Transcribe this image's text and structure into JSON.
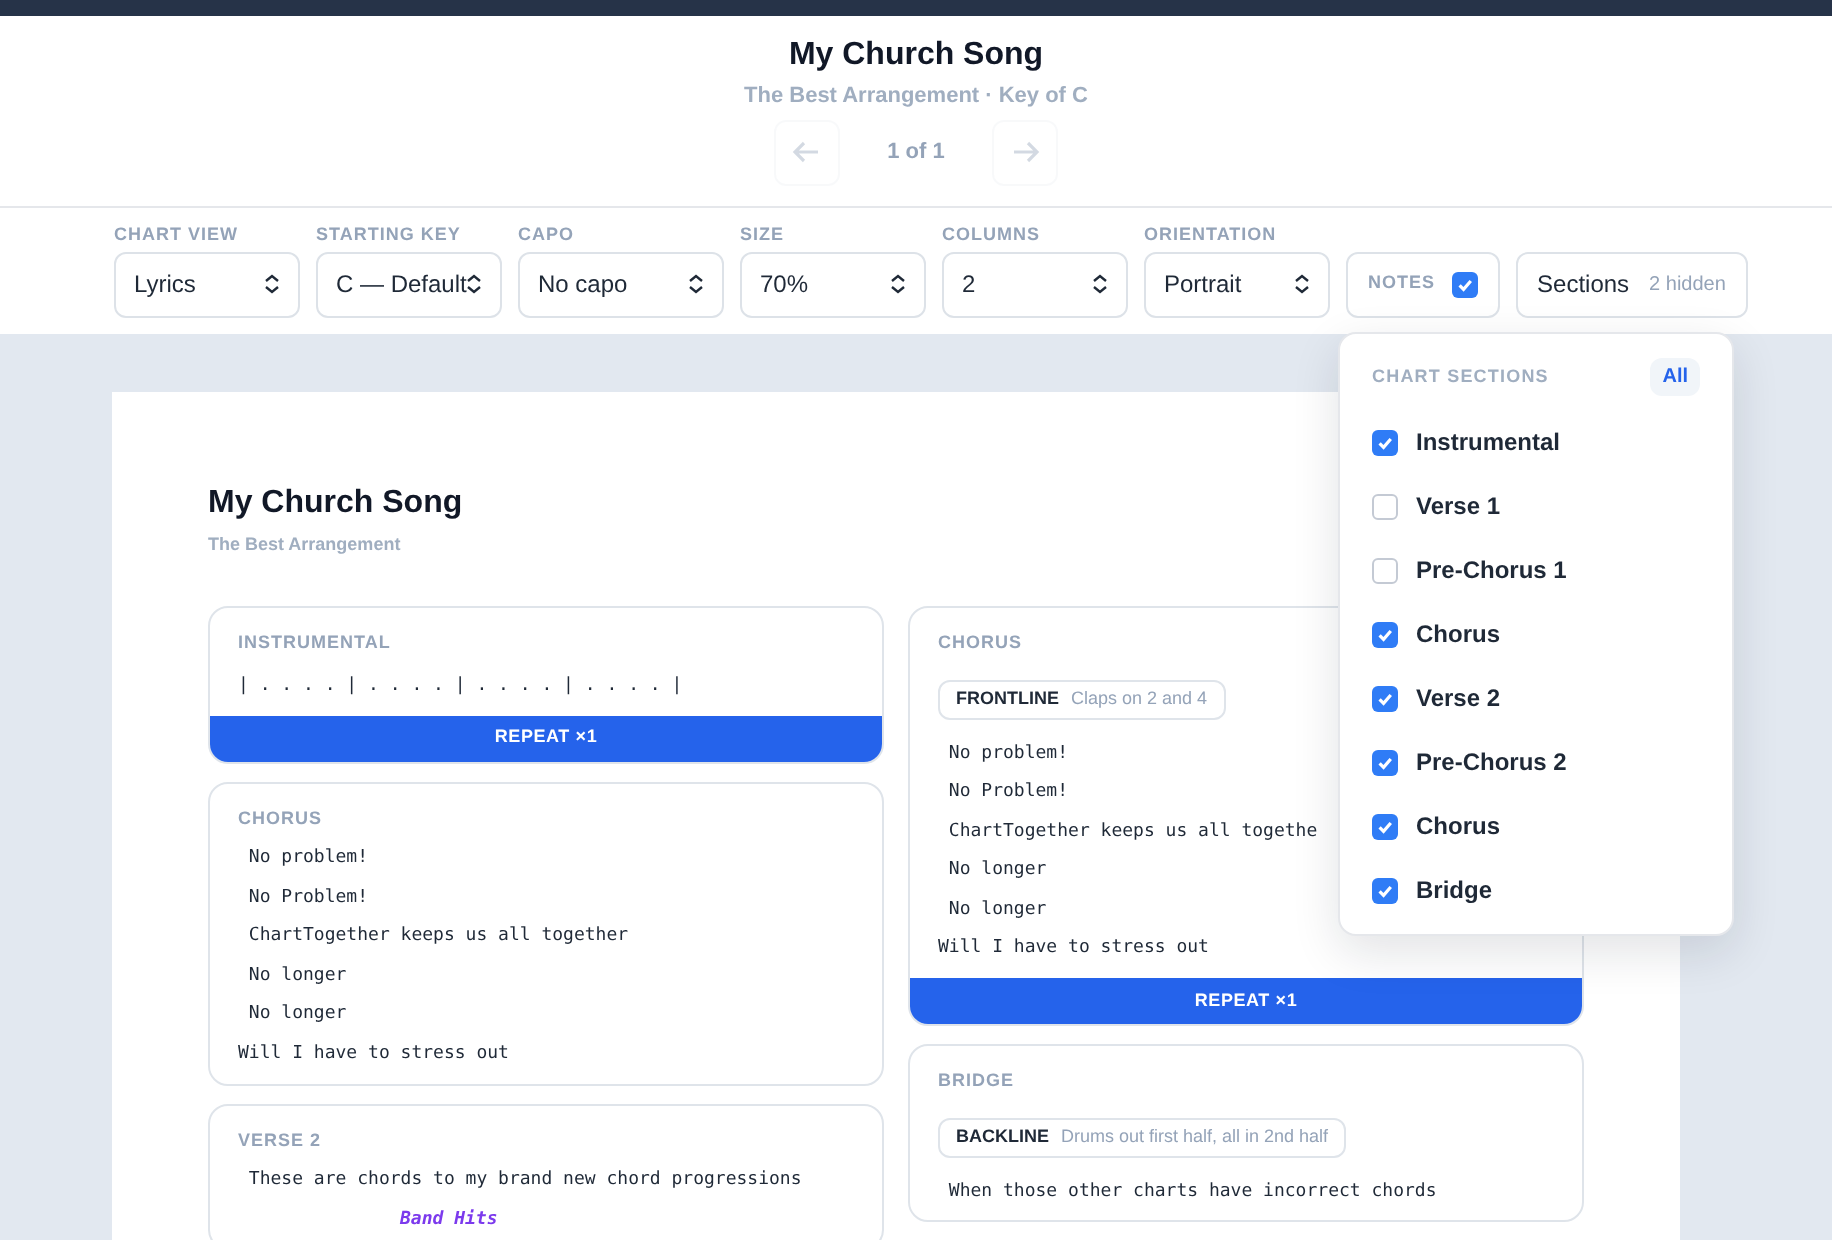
{
  "header": {
    "title": "My Church Song",
    "subtitle": "The Best Arrangement · Key of C",
    "pager": {
      "label": "1 of 1",
      "prev": {
        "disabled": true
      },
      "next": {
        "disabled": true
      }
    }
  },
  "controls": [
    {
      "kind": "select",
      "label": "CHART VIEW",
      "value": "Lyrics"
    },
    {
      "kind": "select",
      "label": "STARTING KEY",
      "value": "C — Default"
    },
    {
      "kind": "select",
      "label": "CAPO",
      "value": "No capo"
    },
    {
      "kind": "select",
      "label": "SIZE",
      "value": "70%"
    },
    {
      "kind": "select",
      "label": "COLUMNS",
      "value": "2"
    },
    {
      "kind": "select",
      "label": "ORIENTATION",
      "value": "Portrait"
    },
    {
      "kind": "checkbox",
      "label": "NOTES",
      "checked": true
    },
    {
      "kind": "button",
      "label": "Sections",
      "badge": "2 hidden"
    }
  ],
  "sections_menu": {
    "title": "CHART SECTIONS",
    "all_label": "All",
    "items": [
      {
        "label": "Instrumental",
        "checked": true
      },
      {
        "label": "Verse 1",
        "checked": false
      },
      {
        "label": "Pre-Chorus 1",
        "checked": false
      },
      {
        "label": "Chorus",
        "checked": true
      },
      {
        "label": "Verse 2",
        "checked": true
      },
      {
        "label": "Pre-Chorus 2",
        "checked": true
      },
      {
        "label": "Chorus",
        "checked": true
      },
      {
        "label": "Bridge",
        "checked": true
      }
    ]
  },
  "sheet": {
    "title": "My Church Song",
    "subtitle": "The Best Arrangement",
    "columns": [
      [
        {
          "heading": "INSTRUMENTAL",
          "lines": [
            {
              "kind": "bars",
              "text": "| . . . . | . . . . | . . . . | . . . . |"
            }
          ],
          "repeat": "REPEAT ×1"
        },
        {
          "heading": "CHORUS",
          "lines": [
            {
              "kind": "lyric",
              "text": " No problem!"
            },
            {
              "kind": "lyric",
              "text": " No Problem!"
            },
            {
              "kind": "lyric",
              "text": " ChartTogether keeps us all together"
            },
            {
              "kind": "lyric",
              "text": " No longer"
            },
            {
              "kind": "lyric",
              "text": " No longer"
            },
            {
              "kind": "lyric",
              "text": "Will I have to stress out"
            }
          ]
        },
        {
          "heading": "VERSE 2",
          "lines": [
            {
              "kind": "lyric",
              "text": " These are chords to my brand new chord progressions"
            },
            {
              "kind": "annotation",
              "text": "Band Hits"
            }
          ]
        }
      ],
      [
        {
          "heading": "CHORUS",
          "note": {
            "tag": "FRONTLINE",
            "text": "Claps on 2 and 4"
          },
          "lines": [
            {
              "kind": "lyric",
              "text": " No problem!"
            },
            {
              "kind": "lyric",
              "text": " No Problem!"
            },
            {
              "kind": "lyric",
              "text": " ChartTogether keeps us all togethe"
            },
            {
              "kind": "lyric",
              "text": " No longer"
            },
            {
              "kind": "lyric",
              "text": " No longer"
            },
            {
              "kind": "lyric",
              "text": "Will I have to stress out"
            }
          ],
          "repeat": "REPEAT ×1"
        },
        {
          "heading": "BRIDGE",
          "note": {
            "tag": "BACKLINE",
            "text": "Drums out first half, all in 2nd half"
          },
          "lines": [
            {
              "kind": "lyric",
              "text": " When those other charts have incorrect chords"
            }
          ]
        }
      ]
    ]
  }
}
